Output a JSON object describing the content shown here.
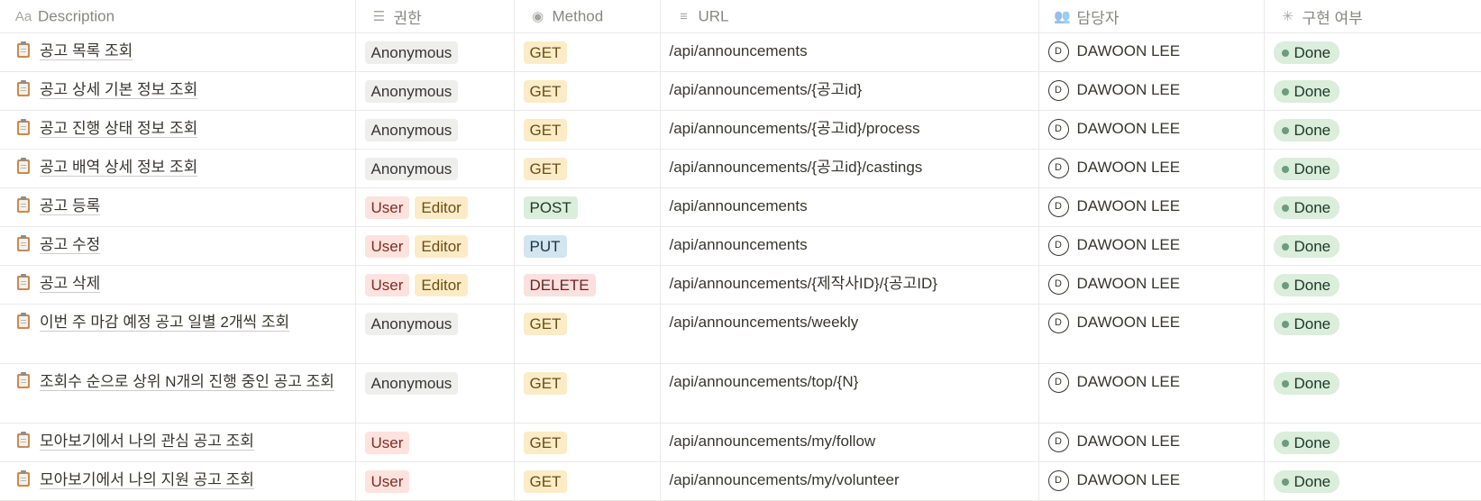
{
  "columns": [
    {
      "icon": "text-icon",
      "glyph": "Aa",
      "label": "Description"
    },
    {
      "icon": "list-icon",
      "glyph": "☰",
      "label": "권한"
    },
    {
      "icon": "select-icon",
      "glyph": "◉",
      "label": "Method"
    },
    {
      "icon": "lines-icon",
      "glyph": "≡",
      "label": "URL"
    },
    {
      "icon": "people-icon",
      "glyph": "👥",
      "label": "담당자"
    },
    {
      "icon": "status-icon",
      "glyph": "✳",
      "label": "구현 여부"
    }
  ],
  "tag_colors": {
    "Anonymous": "#eeeeed",
    "User": "#fde2dd",
    "Editor": "#fbecc7",
    "GET": "#fbecc7",
    "POST": "#dbeddb",
    "PUT": "#d3e5ef",
    "DELETE": "#fbe0e0",
    "Done": "#dbeddb"
  },
  "rows": [
    {
      "description": "공고 목록 조회",
      "roles": [
        "Anonymous"
      ],
      "method": "GET",
      "url": "/api/announcements",
      "assignee": "DAWOON LEE",
      "avatar": "D",
      "status": "Done"
    },
    {
      "description": "공고 상세 기본 정보 조회",
      "roles": [
        "Anonymous"
      ],
      "method": "GET",
      "url": "/api/announcements/{공고id}",
      "assignee": "DAWOON LEE",
      "avatar": "D",
      "status": "Done"
    },
    {
      "description": "공고 진행 상태 정보 조회",
      "roles": [
        "Anonymous"
      ],
      "method": "GET",
      "url": "/api/announcements/{공고id}/process",
      "assignee": "DAWOON LEE",
      "avatar": "D",
      "status": "Done"
    },
    {
      "description": "공고 배역 상세 정보 조회",
      "roles": [
        "Anonymous"
      ],
      "method": "GET",
      "url": "/api/announcements/{공고id}/castings",
      "assignee": "DAWOON LEE",
      "avatar": "D",
      "status": "Done"
    },
    {
      "description": "공고 등록",
      "roles": [
        "User",
        "Editor"
      ],
      "method": "POST",
      "url": "/api/announcements",
      "assignee": "DAWOON LEE",
      "avatar": "D",
      "status": "Done"
    },
    {
      "description": "공고 수정",
      "roles": [
        "User",
        "Editor"
      ],
      "method": "PUT",
      "url": "/api/announcements",
      "assignee": "DAWOON LEE",
      "avatar": "D",
      "status": "Done"
    },
    {
      "description": "공고 삭제",
      "roles": [
        "User",
        "Editor"
      ],
      "method": "DELETE",
      "url": "/api/announcements/{제작사ID}/{공고ID}",
      "assignee": "DAWOON LEE",
      "avatar": "D",
      "status": "Done"
    },
    {
      "description": "이번 주 마감 예정 공고 일별 2개씩 조회",
      "roles": [
        "Anonymous"
      ],
      "method": "GET",
      "url": "/api/announcements/weekly",
      "assignee": "DAWOON LEE",
      "avatar": "D",
      "status": "Done"
    },
    {
      "description": "조회수 순으로 상위 N개의 진행 중인 공고 조회",
      "roles": [
        "Anonymous"
      ],
      "method": "GET",
      "url": "/api/announcements/top/{N}",
      "assignee": "DAWOON LEE",
      "avatar": "D",
      "status": "Done"
    },
    {
      "description": "모아보기에서 나의 관심 공고 조회",
      "roles": [
        "User"
      ],
      "method": "GET",
      "url": "/api/announcements/my/follow",
      "assignee": "DAWOON LEE",
      "avatar": "D",
      "status": "Done"
    },
    {
      "description": "모아보기에서 나의 지원 공고 조회",
      "roles": [
        "User"
      ],
      "method": "GET",
      "url": "/api/announcements/my/volunteer",
      "assignee": "DAWOON LEE",
      "avatar": "D",
      "status": "Done"
    }
  ]
}
